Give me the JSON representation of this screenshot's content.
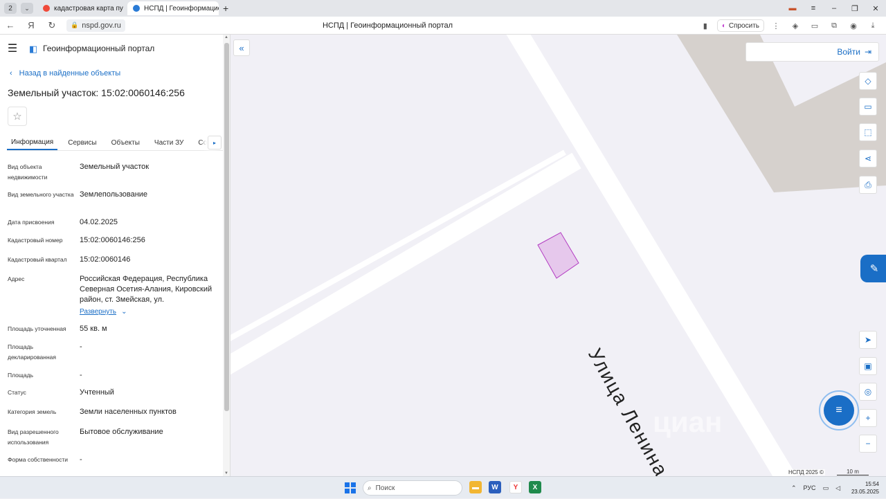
{
  "browser": {
    "tab_count": "2",
    "tabs": [
      {
        "label": "кадастровая карта публи"
      },
      {
        "label": "НСПД | Геоинформацио"
      }
    ],
    "url": "nspd.gov.ru",
    "page_title": "НСПД | Геоинформационный портал",
    "ask_label": "Спросить"
  },
  "sidebar": {
    "portal_name": "Геоинформационный портал",
    "back_label": "Назад в найденные объекты",
    "parcel_title": "Земельный участок: 15:02:0060146:256",
    "tabs": [
      "Информация",
      "Сервисы",
      "Объекты",
      "Части ЗУ",
      "Состав"
    ],
    "active_tab": "Информация",
    "properties": [
      {
        "key": "Вид объекта недвижимости",
        "value": "Земельный участок"
      },
      {
        "key": "Вид земельного участка",
        "value": "Землепользование"
      },
      {
        "key": "Дата присвоения",
        "value": "04.02.2025"
      },
      {
        "key": "Кадастровый номер",
        "value": "15:02:0060146:256"
      },
      {
        "key": "Кадастровый квартал",
        "value": "15:02:0060146"
      },
      {
        "key": "Адрес",
        "value": "Российская Федерация, Республика Северная Осетия-Алания, Кировский район, ст. Змейская, ул."
      },
      {
        "key": "Площадь уточненная",
        "value": "55 кв. м"
      },
      {
        "key": "Площадь декларированная",
        "value": "-"
      },
      {
        "key": "Площадь",
        "value": "-"
      },
      {
        "key": "Статус",
        "value": "Учтенный"
      },
      {
        "key": "Категория земель",
        "value": "Земли населенных пунктов"
      },
      {
        "key": "Вид разрешенного использования",
        "value": "Бытовое обслуживание"
      },
      {
        "key": "Форма собственности",
        "value": "-"
      }
    ],
    "expand_label": "Развернуть"
  },
  "map": {
    "login_label": "Войти",
    "street_label": "Улица Ленина",
    "copyright": "НСПД 2025 ©",
    "scale_label": "10 m",
    "parcel_fill": "#e6c8ec",
    "parcel_stroke": "#b33cc2",
    "building_color": "#d6d1cd",
    "road_color": "#ffffff",
    "accent": "#1a6ec6",
    "watermark": "циан"
  },
  "taskbar": {
    "search_placeholder": "Поиск",
    "lang": "РУС",
    "time": "15:54",
    "date": "23.05.2025"
  }
}
